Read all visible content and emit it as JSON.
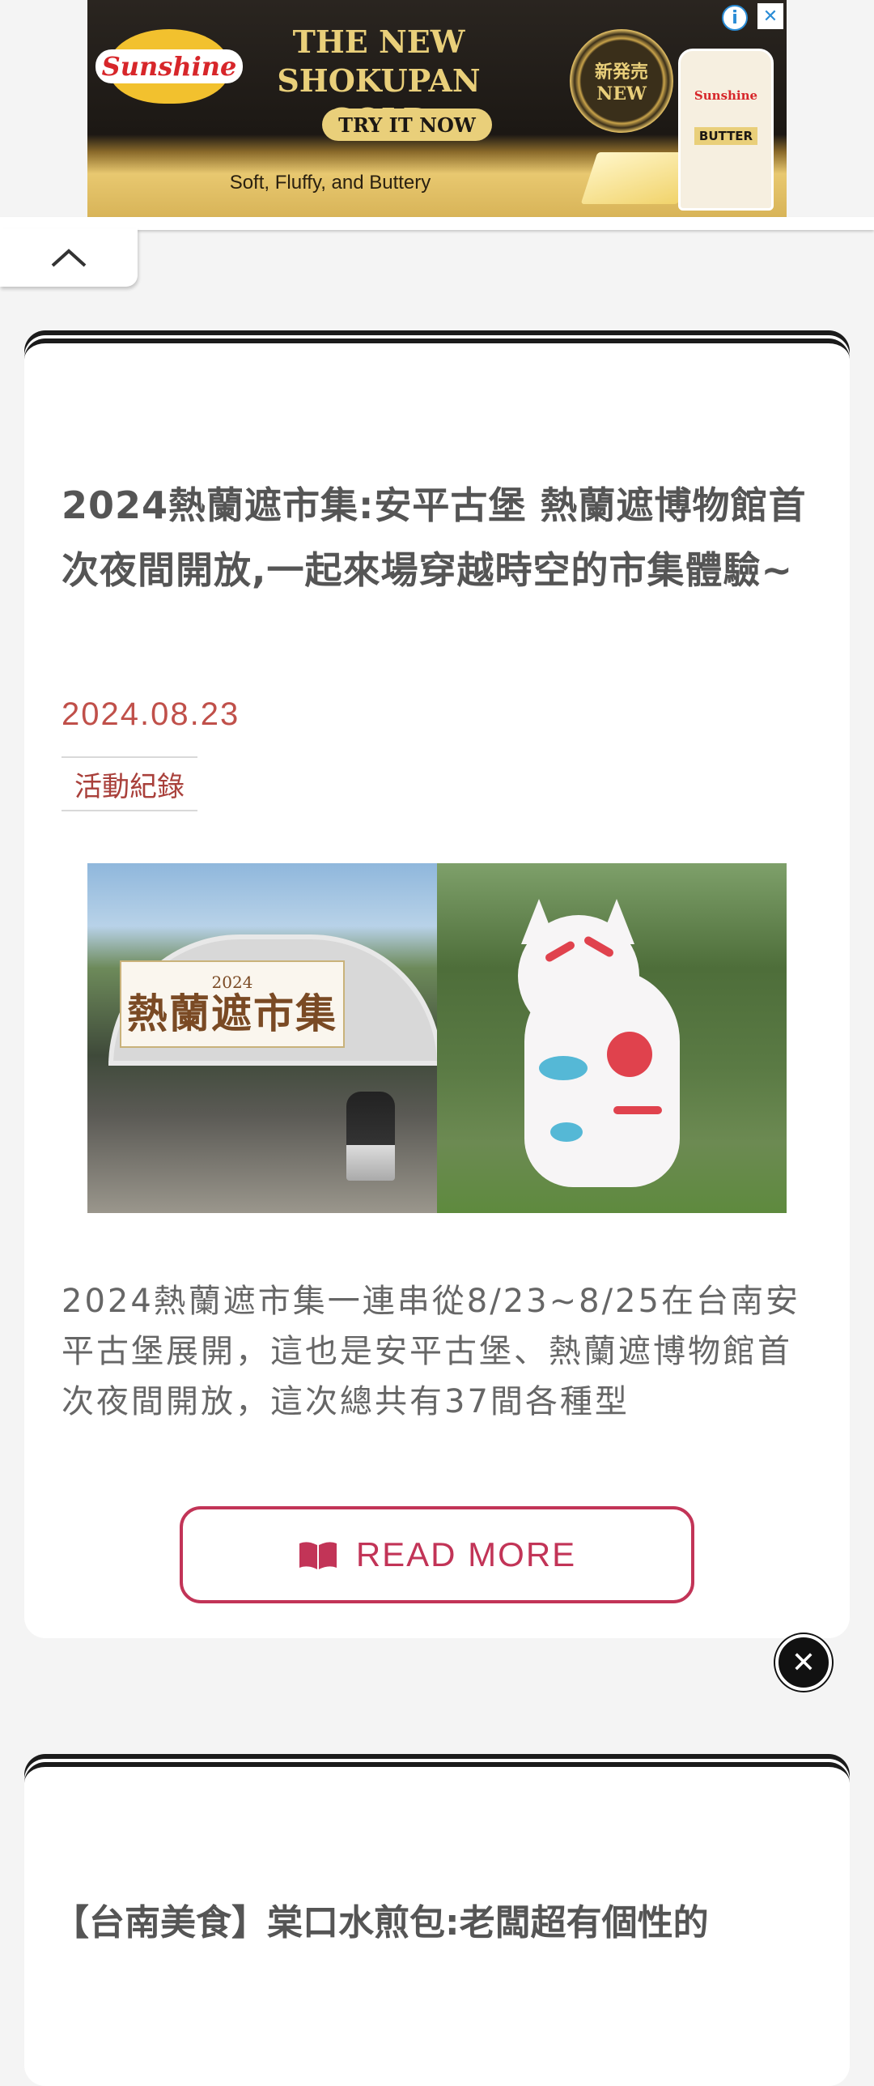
{
  "ad": {
    "brand": "Sunshine",
    "headline_line1": "THE NEW",
    "headline_line2": "SHOKUPAN GOLD",
    "cta": "TRY IT NOW",
    "tagline": "Soft, Fluffy, and Buttery",
    "seal_top": "新発売",
    "seal_bottom": "NEW",
    "package_label": "BUTTER",
    "info_icon": "info-icon",
    "close_icon": "close-icon"
  },
  "article": {
    "title": "2024熱蘭遮市集:安平古堡 熱蘭遮博物館首次夜間開放,一起來場穿越時空的市集體驗~",
    "date": "2024.08.23",
    "category": "活動紀錄",
    "image_banner_year": "2024",
    "image_banner_name": "熱蘭遮市集",
    "excerpt": "2024熱蘭遮市集一連串從8/23~8/25在台南安平古堡展開，這也是安平古堡、熱蘭遮博物館首次夜間開放，這次總共有37間各種型",
    "read_more": "READ MORE",
    "read_more_icon": "book-icon"
  },
  "next_article": {
    "title": "【台南美食】棠口水煎包:老闆超有個性的"
  },
  "colors": {
    "accent": "#c23457",
    "date": "#c0504a",
    "tag": "#a9403b"
  }
}
